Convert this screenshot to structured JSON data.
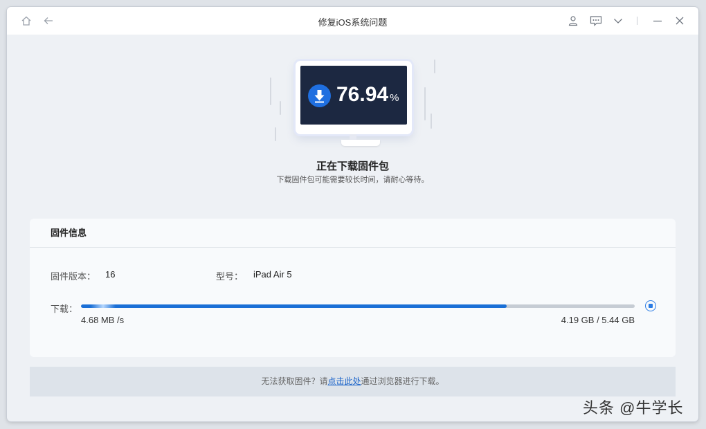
{
  "window": {
    "title": "修复iOS系统问题"
  },
  "titlebar": {
    "left_icons": [
      "home-icon",
      "back-arrow-icon"
    ],
    "right_icons": [
      "user-icon",
      "feedback-icon",
      "chevron-down-icon",
      "minimize-icon",
      "close-icon"
    ]
  },
  "progress_display": {
    "value": "76.94",
    "unit": "%"
  },
  "status": {
    "title": "正在下载固件包",
    "subtitle": "下载固件包可能需要较长时间，请耐心等待。"
  },
  "firmware": {
    "heading": "固件信息",
    "version_label": "固件版本：",
    "version_value": "16",
    "model_label": "型号：",
    "model_value": "iPad Air 5",
    "download_label": "下载：",
    "progress_fraction": 0.769,
    "speed": "4.68 MB /s",
    "size": "4.19 GB / 5.44 GB"
  },
  "footer": {
    "prefix": "无法获取固件？请",
    "link": "点击此处",
    "suffix": "通过浏览器进行下载。"
  },
  "watermark": "头条 @牛学长",
  "colors": {
    "accent": "#1a6fd6",
    "screen": "#1c2841"
  }
}
